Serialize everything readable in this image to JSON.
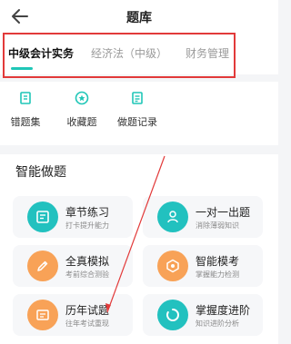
{
  "header": {
    "title": "题库",
    "back_icon": "back-arrow-icon"
  },
  "tabs": [
    {
      "label": "中级会计实务",
      "active": true
    },
    {
      "label": "经济法（中级）",
      "active": false
    },
    {
      "label": "财务管理",
      "active": false
    }
  ],
  "quick": [
    {
      "label": "错题集",
      "icon": "notebook-icon"
    },
    {
      "label": "收藏题",
      "icon": "star-icon"
    },
    {
      "label": "做题记录",
      "icon": "record-icon"
    }
  ],
  "section": {
    "title": "智能做题"
  },
  "tiles": [
    {
      "title": "章节练习",
      "subtitle": "打卡提升能力",
      "icon": "chapter-icon",
      "color": "#22c1bf"
    },
    {
      "title": "一对一出题",
      "subtitle": "消除薄弱知识",
      "icon": "one-on-one-icon",
      "color": "#22c1bf"
    },
    {
      "title": "全真模拟",
      "subtitle": "考前综合测验",
      "icon": "exam-pencil-icon",
      "color": "#f8a257"
    },
    {
      "title": "智能模考",
      "subtitle": "掌握能力检测",
      "icon": "smart-exam-icon",
      "color": "#f8a257"
    },
    {
      "title": "历年试题",
      "subtitle": "往年考试重现",
      "icon": "past-papers-icon",
      "color": "#f8a257"
    },
    {
      "title": "掌握度进阶",
      "subtitle": "知识进阶分析",
      "icon": "mastery-ring-icon",
      "color": "#22c1bf"
    }
  ],
  "colors": {
    "accent": "#1fc6b7",
    "orange": "#f8a257",
    "annotation_red": "#e23a3a"
  }
}
